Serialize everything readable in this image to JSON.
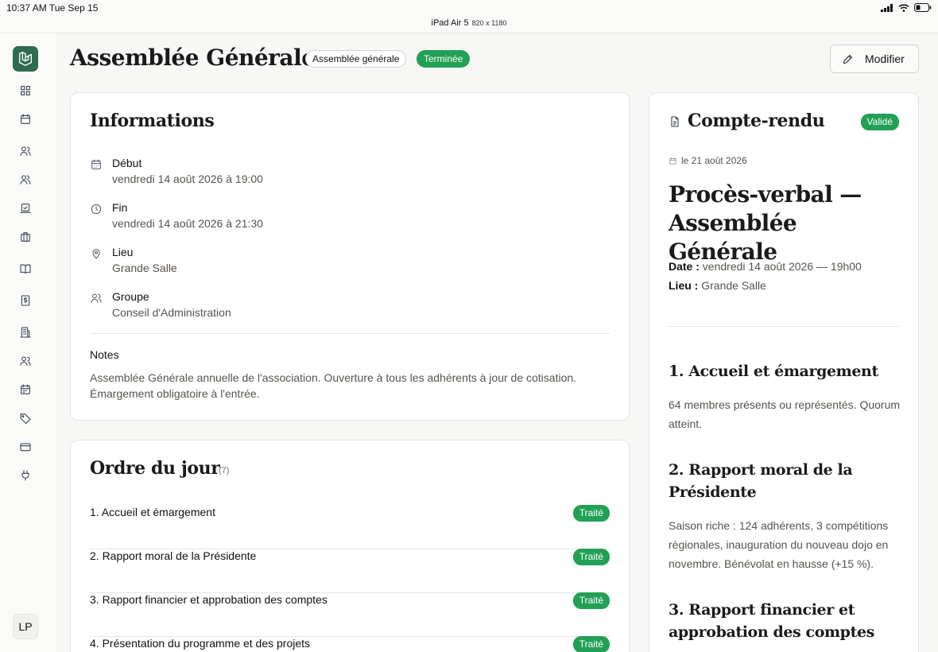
{
  "status_bar": {
    "time": "10:37 AM  Tue Sep 15",
    "device": "iPad Air 5",
    "device_dims": "820 x 1180"
  },
  "sidebar": {
    "items": [
      {
        "icon": "dashboard-icon"
      },
      {
        "icon": "calendar-icon"
      },
      {
        "icon": "users-icon"
      },
      {
        "icon": "team-icon"
      },
      {
        "icon": "attendance-icon"
      },
      {
        "icon": "briefcase-icon"
      },
      {
        "icon": "book-icon"
      },
      {
        "icon": "finance-icon"
      },
      {
        "icon": "building-icon"
      },
      {
        "icon": "members-icon"
      },
      {
        "icon": "calendar-alt-icon"
      },
      {
        "icon": "tag-icon"
      },
      {
        "icon": "card-icon"
      },
      {
        "icon": "plug-icon"
      }
    ],
    "avatar": "LP"
  },
  "header": {
    "title": "Assemblée Générale",
    "type_tag": "Assemblée générale",
    "status_tag": "Terminée",
    "edit_label": "Modifier"
  },
  "info": {
    "title": "Informations",
    "rows": [
      {
        "icon": "calendar-icon",
        "label": "Début",
        "value": "vendredi 14 août 2026 à 19:00"
      },
      {
        "icon": "clock-icon",
        "label": "Fin",
        "value": "vendredi 14 août 2026 à 21:30"
      },
      {
        "icon": "map-pin-icon",
        "label": "Lieu",
        "value": "Grande Salle"
      },
      {
        "icon": "users-icon",
        "label": "Groupe",
        "value": "Conseil d'Administration"
      }
    ],
    "notes_label": "Notes",
    "notes": "Assemblée Générale annuelle de l'association. Ouverture à tous les adhérents à jour de cotisation. Émargement obligatoire à l'entrée."
  },
  "agenda": {
    "title": "Ordre du jour",
    "count": "(7)",
    "items": [
      {
        "label": "1. Accueil et émargement",
        "status": "Traité"
      },
      {
        "label": "2. Rapport moral de la Présidente",
        "status": "Traité"
      },
      {
        "label": "3. Rapport financier et approbation des comptes",
        "status": "Traité"
      },
      {
        "label": "4. Présentation du programme et des projets",
        "status": "Traité"
      }
    ]
  },
  "minutes": {
    "title": "Compte-rendu",
    "status": "Validé",
    "date": "le 21 août 2026",
    "heading": "Procès-verbal — Assemblée Générale",
    "date_label": "Date :",
    "date_value": "vendredi 14 août 2026 — 19h00",
    "place_label": "Lieu :",
    "place_value": "Grande Salle",
    "sections": [
      {
        "title": "1. Accueil et émargement",
        "body": "64 membres présents ou représentés. Quorum atteint."
      },
      {
        "title": "2. Rapport moral de la Présidente",
        "body": "Saison riche : 124 adhérents, 3 compétitions régionales, inauguration du nouveau dojo en novembre. Bénévolat en hausse (+15 %)."
      },
      {
        "title": "3. Rapport financier et approbation des comptes",
        "body": ""
      }
    ]
  }
}
